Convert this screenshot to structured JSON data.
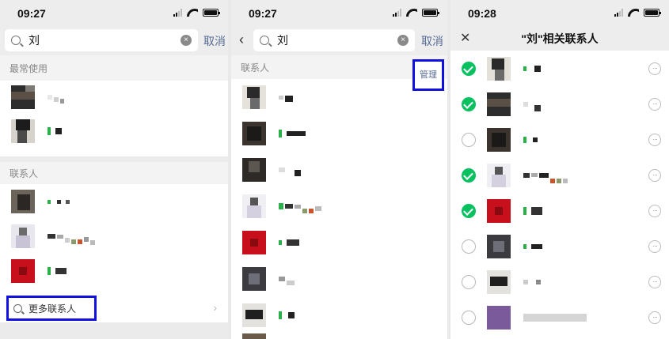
{
  "panel1": {
    "status": {
      "time": "09:27"
    },
    "search": {
      "value": "刘",
      "cancel": "取消"
    },
    "recent_header": "最常使用",
    "contacts_header": "联系人",
    "more_contacts": "更多联系人"
  },
  "panel2": {
    "status": {
      "time": "09:27"
    },
    "search": {
      "value": "刘",
      "cancel": "取消"
    },
    "contacts_header": "联系人",
    "manage_label": "管理"
  },
  "panel3": {
    "status": {
      "time": "09:28"
    },
    "title": "\"刘\"相关联系人",
    "selected": [
      true,
      true,
      false,
      true,
      true,
      false,
      false,
      false
    ],
    "accent": "#07c160"
  },
  "colors": {
    "link": "#576b95",
    "highlight": "#1010e0",
    "accent": "#07c160"
  },
  "icons": {
    "search": "search-icon",
    "clear": "clear-icon",
    "back": "back-icon",
    "close": "close-icon",
    "more": "more-icon",
    "chevron": "chevron-right-icon"
  }
}
